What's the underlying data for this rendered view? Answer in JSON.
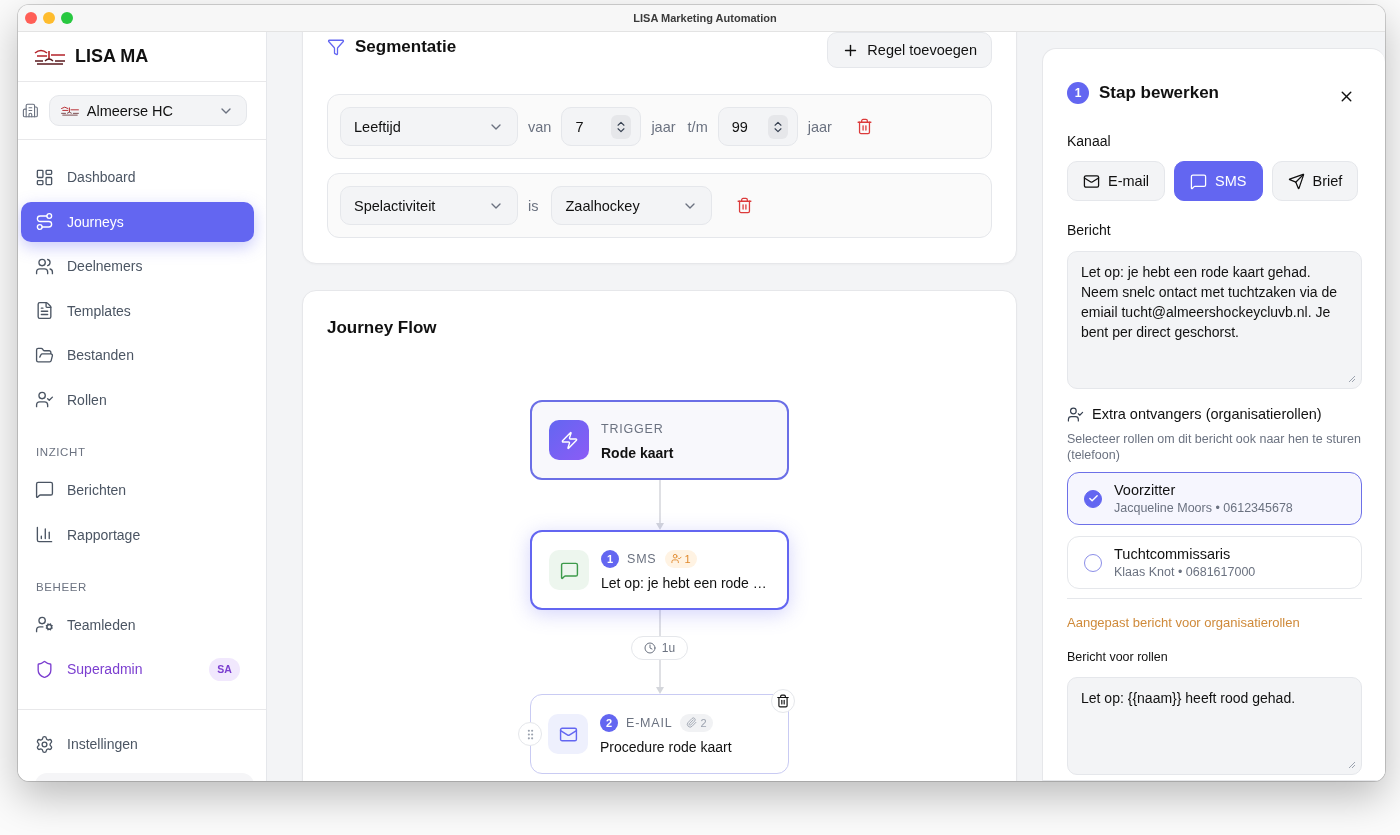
{
  "window": {
    "title": "LISA Marketing Automation"
  },
  "sidebar": {
    "app_name": "LISA MA",
    "org_select": {
      "value": "Almeerse HC"
    },
    "nav": [
      {
        "items": [
          {
            "label": "Dashboard",
            "kind": "page",
            "selected": false
          },
          {
            "label": "Journeys",
            "kind": "page",
            "selected": true
          },
          {
            "label": "Deelnemers",
            "kind": "page",
            "selected": false
          },
          {
            "label": "Templates",
            "kind": "page",
            "selected": false
          },
          {
            "label": "Bestanden",
            "kind": "page",
            "selected": false
          },
          {
            "label": "Rollen",
            "kind": "page",
            "selected": false
          }
        ]
      },
      {
        "heading": "INZICHT",
        "items": [
          {
            "label": "Berichten",
            "kind": "page",
            "selected": false
          },
          {
            "label": "Rapportage",
            "kind": "page",
            "selected": false
          }
        ]
      },
      {
        "heading": "BEHEER",
        "items": [
          {
            "label": "Teamleden",
            "kind": "page",
            "selected": false
          },
          {
            "label": "Superadmin",
            "kind": "admin",
            "badge": "SA",
            "selected": false
          }
        ]
      }
    ],
    "footer_items": [
      {
        "label": "Instellingen",
        "kind": "page",
        "selected": false
      }
    ]
  },
  "segmentation": {
    "title": "Segmentatie",
    "add_button": "Regel toevoegen",
    "rules": [
      {
        "kind": "range",
        "field": "Leeftijd",
        "from_label": "van",
        "from": "7",
        "from_unit": "jaar",
        "to_label": "t/m",
        "to": "99",
        "to_unit": "jaar"
      },
      {
        "kind": "select",
        "field": "Spelactiviteit",
        "operator": "is",
        "value": "Zaalhockey"
      }
    ]
  },
  "journey_flow": {
    "title": "Journey Flow",
    "nodes": [
      {
        "kind": "trigger",
        "type_label": "TRIGGER",
        "title": "Rode kaart",
        "selected": false,
        "hovered": false
      },
      {
        "kind": "sms",
        "step": "1",
        "type_label": "SMS",
        "badge": "1",
        "title": "Let op: je hebt een rode …",
        "selected": true,
        "hovered": false
      },
      {
        "kind": "email",
        "delay": "1u",
        "step": "2",
        "type_label": "E-MAIL",
        "badge": "2",
        "title": "Procedure rode kaart",
        "selected": false,
        "hovered": true
      }
    ]
  },
  "step_editor": {
    "step": "1",
    "title": "Stap bewerken",
    "channel_label": "Kanaal",
    "channels": [
      {
        "label": "E-mail",
        "selected": false
      },
      {
        "label": "SMS",
        "selected": true
      },
      {
        "label": "Brief",
        "selected": false
      }
    ],
    "message_label": "Bericht",
    "message": "Let op: je hebt een rode kaart gehad. Neem snelc ontact met tuchtzaken via de emiail tucht@almeershockeycluvb.nl. Je bent per direct geschorst.",
    "extra_recipients": {
      "title": "Extra ontvangers (organisatierollen)",
      "hint": "Selecteer rollen om dit bericht ook naar hen te sturen (telefoon)",
      "roles": [
        {
          "name": "Voorzitter",
          "contact": "Jacqueline Moors • 0612345678",
          "selected": true
        },
        {
          "name": "Tuchtcommissaris",
          "contact": "Klaas Knot • 0681617000",
          "selected": false
        }
      ]
    },
    "custom_message_link": "Aangepast bericht voor organisatierollen",
    "roles_message_label": "Bericht voor rollen",
    "roles_message": "Let op: {{naam}} heeft rood gehad."
  }
}
